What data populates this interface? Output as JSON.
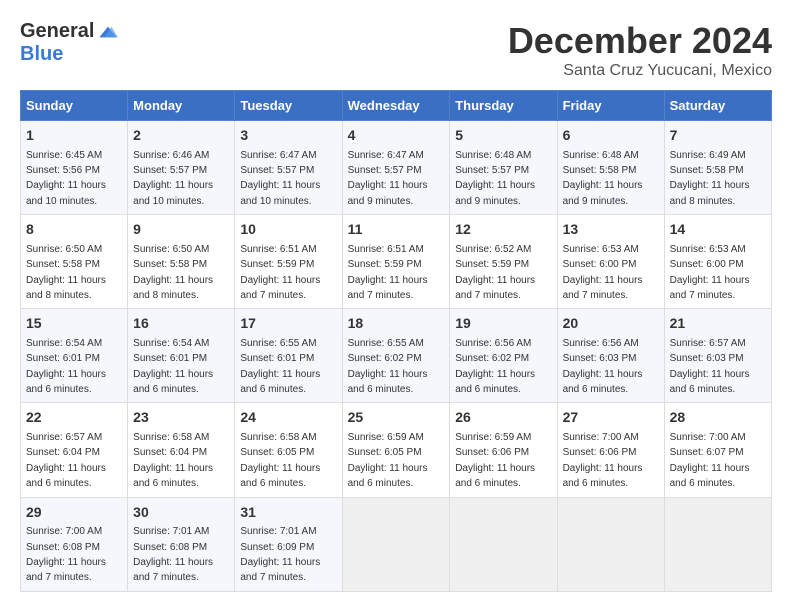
{
  "logo": {
    "general": "General",
    "blue": "Blue"
  },
  "title": "December 2024",
  "location": "Santa Cruz Yucucani, Mexico",
  "days_of_week": [
    "Sunday",
    "Monday",
    "Tuesday",
    "Wednesday",
    "Thursday",
    "Friday",
    "Saturday"
  ],
  "weeks": [
    [
      {
        "day": "1",
        "info": "Sunrise: 6:45 AM\nSunset: 5:56 PM\nDaylight: 11 hours and 10 minutes."
      },
      {
        "day": "2",
        "info": "Sunrise: 6:46 AM\nSunset: 5:57 PM\nDaylight: 11 hours and 10 minutes."
      },
      {
        "day": "3",
        "info": "Sunrise: 6:47 AM\nSunset: 5:57 PM\nDaylight: 11 hours and 10 minutes."
      },
      {
        "day": "4",
        "info": "Sunrise: 6:47 AM\nSunset: 5:57 PM\nDaylight: 11 hours and 9 minutes."
      },
      {
        "day": "5",
        "info": "Sunrise: 6:48 AM\nSunset: 5:57 PM\nDaylight: 11 hours and 9 minutes."
      },
      {
        "day": "6",
        "info": "Sunrise: 6:48 AM\nSunset: 5:58 PM\nDaylight: 11 hours and 9 minutes."
      },
      {
        "day": "7",
        "info": "Sunrise: 6:49 AM\nSunset: 5:58 PM\nDaylight: 11 hours and 8 minutes."
      }
    ],
    [
      {
        "day": "8",
        "info": "Sunrise: 6:50 AM\nSunset: 5:58 PM\nDaylight: 11 hours and 8 minutes."
      },
      {
        "day": "9",
        "info": "Sunrise: 6:50 AM\nSunset: 5:58 PM\nDaylight: 11 hours and 8 minutes."
      },
      {
        "day": "10",
        "info": "Sunrise: 6:51 AM\nSunset: 5:59 PM\nDaylight: 11 hours and 7 minutes."
      },
      {
        "day": "11",
        "info": "Sunrise: 6:51 AM\nSunset: 5:59 PM\nDaylight: 11 hours and 7 minutes."
      },
      {
        "day": "12",
        "info": "Sunrise: 6:52 AM\nSunset: 5:59 PM\nDaylight: 11 hours and 7 minutes."
      },
      {
        "day": "13",
        "info": "Sunrise: 6:53 AM\nSunset: 6:00 PM\nDaylight: 11 hours and 7 minutes."
      },
      {
        "day": "14",
        "info": "Sunrise: 6:53 AM\nSunset: 6:00 PM\nDaylight: 11 hours and 7 minutes."
      }
    ],
    [
      {
        "day": "15",
        "info": "Sunrise: 6:54 AM\nSunset: 6:01 PM\nDaylight: 11 hours and 6 minutes."
      },
      {
        "day": "16",
        "info": "Sunrise: 6:54 AM\nSunset: 6:01 PM\nDaylight: 11 hours and 6 minutes."
      },
      {
        "day": "17",
        "info": "Sunrise: 6:55 AM\nSunset: 6:01 PM\nDaylight: 11 hours and 6 minutes."
      },
      {
        "day": "18",
        "info": "Sunrise: 6:55 AM\nSunset: 6:02 PM\nDaylight: 11 hours and 6 minutes."
      },
      {
        "day": "19",
        "info": "Sunrise: 6:56 AM\nSunset: 6:02 PM\nDaylight: 11 hours and 6 minutes."
      },
      {
        "day": "20",
        "info": "Sunrise: 6:56 AM\nSunset: 6:03 PM\nDaylight: 11 hours and 6 minutes."
      },
      {
        "day": "21",
        "info": "Sunrise: 6:57 AM\nSunset: 6:03 PM\nDaylight: 11 hours and 6 minutes."
      }
    ],
    [
      {
        "day": "22",
        "info": "Sunrise: 6:57 AM\nSunset: 6:04 PM\nDaylight: 11 hours and 6 minutes."
      },
      {
        "day": "23",
        "info": "Sunrise: 6:58 AM\nSunset: 6:04 PM\nDaylight: 11 hours and 6 minutes."
      },
      {
        "day": "24",
        "info": "Sunrise: 6:58 AM\nSunset: 6:05 PM\nDaylight: 11 hours and 6 minutes."
      },
      {
        "day": "25",
        "info": "Sunrise: 6:59 AM\nSunset: 6:05 PM\nDaylight: 11 hours and 6 minutes."
      },
      {
        "day": "26",
        "info": "Sunrise: 6:59 AM\nSunset: 6:06 PM\nDaylight: 11 hours and 6 minutes."
      },
      {
        "day": "27",
        "info": "Sunrise: 7:00 AM\nSunset: 6:06 PM\nDaylight: 11 hours and 6 minutes."
      },
      {
        "day": "28",
        "info": "Sunrise: 7:00 AM\nSunset: 6:07 PM\nDaylight: 11 hours and 6 minutes."
      }
    ],
    [
      {
        "day": "29",
        "info": "Sunrise: 7:00 AM\nSunset: 6:08 PM\nDaylight: 11 hours and 7 minutes."
      },
      {
        "day": "30",
        "info": "Sunrise: 7:01 AM\nSunset: 6:08 PM\nDaylight: 11 hours and 7 minutes."
      },
      {
        "day": "31",
        "info": "Sunrise: 7:01 AM\nSunset: 6:09 PM\nDaylight: 11 hours and 7 minutes."
      },
      null,
      null,
      null,
      null
    ]
  ]
}
